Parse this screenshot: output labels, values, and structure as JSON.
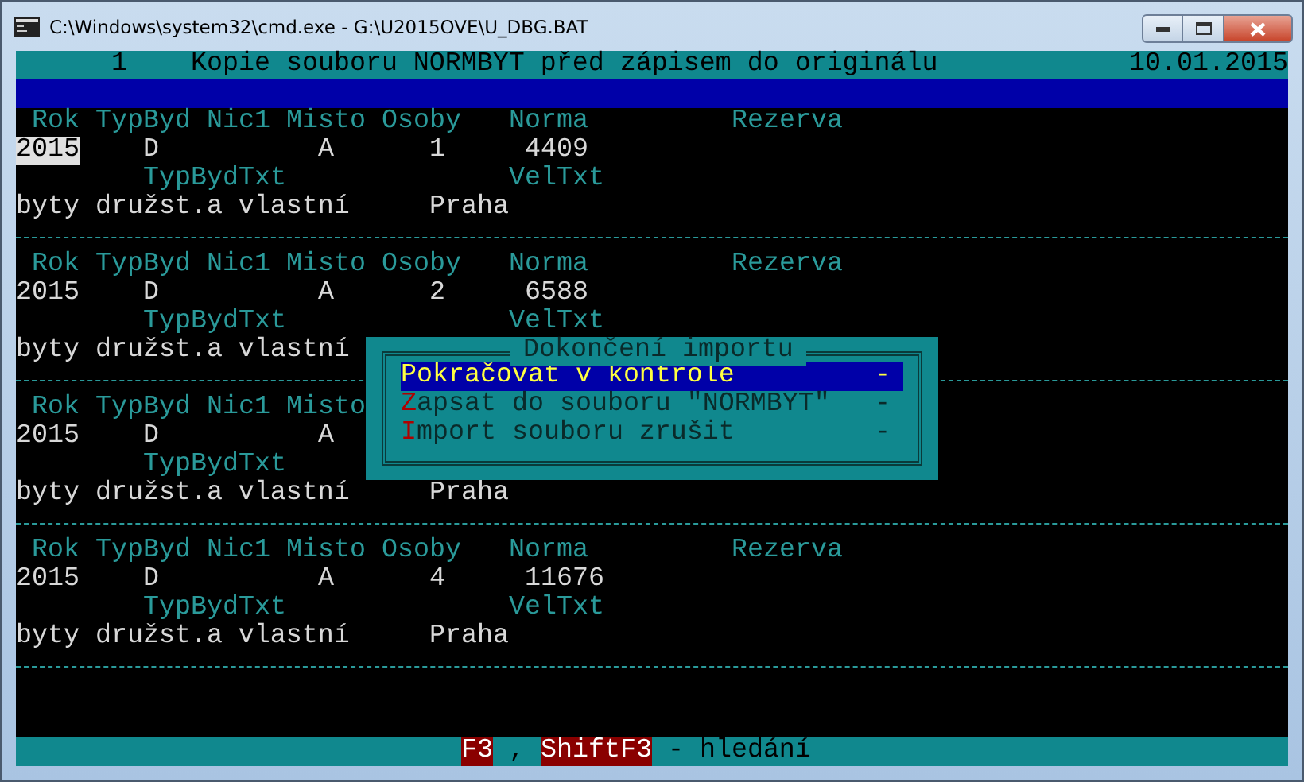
{
  "window": {
    "title": "C:\\Windows\\system32\\cmd.exe - G:\\U2015OVE\\U_DBG.BAT"
  },
  "header": {
    "number": "1",
    "title": "Kopie souboru NORMBYT před zápisem do originálu",
    "date": "10.01.2015"
  },
  "records": [
    {
      "selected": true,
      "labels": [
        "Rok",
        "TypByd",
        "Nic1",
        "Misto",
        "Osoby",
        "Norma",
        "Rezerva"
      ],
      "values": [
        "2015",
        "D",
        "A",
        "1",
        "4409"
      ],
      "sublabels": [
        "TypBydTxt",
        "VelTxt"
      ],
      "subvalues": [
        "byty družst.a vlastní",
        "Praha"
      ]
    },
    {
      "selected": false,
      "labels": [
        "Rok",
        "TypByd",
        "Nic1",
        "Misto",
        "Osoby",
        "Norma",
        "Rezerva"
      ],
      "values": [
        "2015",
        "D",
        "A",
        "2",
        "6588"
      ],
      "sublabels": [
        "TypBydTxt",
        "VelTxt"
      ],
      "subvalues": [
        "byty družst.a vlastní"
      ]
    },
    {
      "selected": false,
      "labels": [
        "Rok",
        "TypByd",
        "Nic1",
        "Misto"
      ],
      "values": [
        "2015",
        "D",
        "A"
      ],
      "sublabels": [
        "TypBydTxt"
      ],
      "subvalues": [
        "byty družst.a vlastní",
        "Praha"
      ]
    },
    {
      "selected": false,
      "labels": [
        "Rok",
        "TypByd",
        "Nic1",
        "Misto",
        "Osoby",
        "Norma",
        "Rezerva"
      ],
      "values": [
        "2015",
        "D",
        "A",
        "4",
        "11676"
      ],
      "sublabels": [
        "TypBydTxt",
        "VelTxt"
      ],
      "subvalues": [
        "byty družst.a vlastní",
        "Praha"
      ]
    }
  ],
  "dialog": {
    "title": "Dokončení importu",
    "items": [
      {
        "label": "Pokračovat v kontrole",
        "shortcut": "-",
        "hotkey": true,
        "selected": true
      },
      {
        "label": "Zapsat do souboru \"NORMBYT\"",
        "shortcut": "-",
        "hotkey": true,
        "selected": false
      },
      {
        "label": "Import souboru zrušit",
        "shortcut": "-",
        "hotkey": true,
        "selected": false
      }
    ]
  },
  "status_bar": {
    "items": [
      {
        "kind": "key",
        "text": "F3"
      },
      {
        "kind": "plain",
        "text": ","
      },
      {
        "kind": "key",
        "text": "ShiftF3"
      },
      {
        "kind": "plain",
        "text": "- hledání"
      }
    ]
  }
}
